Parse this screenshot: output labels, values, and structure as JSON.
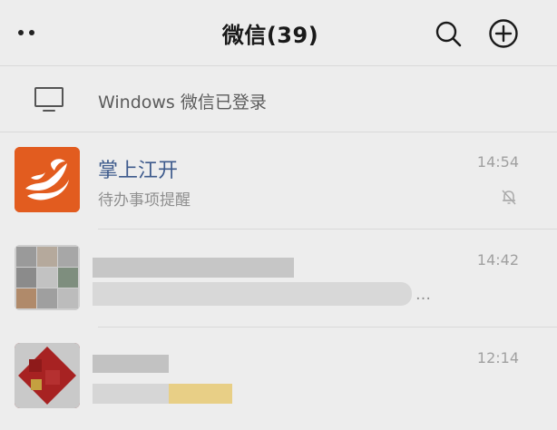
{
  "header": {
    "title": "微信(39)",
    "menu_icon": "more-dots-icon",
    "search_icon": "search-icon",
    "add_icon": "plus-circle-icon"
  },
  "device_banner": {
    "icon": "monitor-icon",
    "text": "Windows 微信已登录"
  },
  "chats": [
    {
      "name": "掌上江开",
      "preview": "待办事项提醒",
      "time": "14:54",
      "muted": true,
      "avatar_color": "#e25c1f"
    },
    {
      "name": "",
      "preview": "…",
      "time": "14:42",
      "blurred": true
    },
    {
      "name": "",
      "preview": "",
      "time": "12:14",
      "blurred": true
    }
  ],
  "colors": {
    "background": "#ededed",
    "name_blue": "#3d5a8c",
    "time_gray": "#a0a0a0",
    "brand_orange": "#e25c1f"
  }
}
